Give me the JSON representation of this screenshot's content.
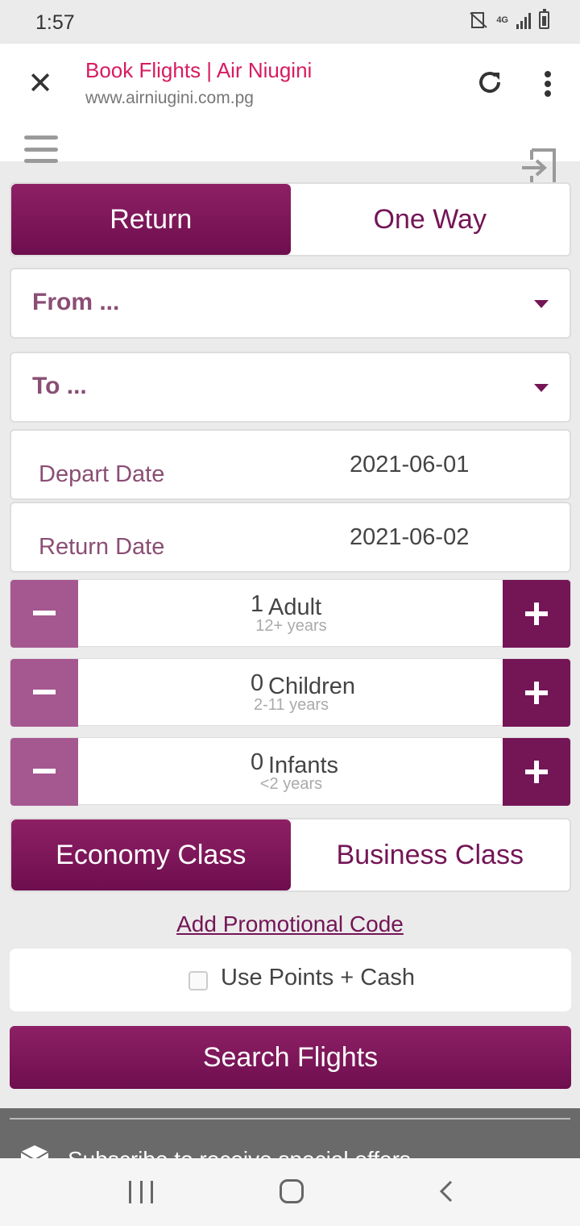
{
  "status_bar": {
    "time": "1:57",
    "network": "4G"
  },
  "browser": {
    "title": "Book Flights | Air Niugini",
    "url": "www.airniugini.com.pg"
  },
  "trip_type": {
    "options": [
      "Return",
      "One Way"
    ],
    "selected": "Return"
  },
  "from": {
    "placeholder": "From ..."
  },
  "to": {
    "placeholder": "To ..."
  },
  "dates": {
    "depart_label": "Depart Date",
    "depart_value": "2021-06-01",
    "return_label": "Return Date",
    "return_value": "2021-06-02"
  },
  "passengers": [
    {
      "count": "1",
      "label": "Adult",
      "sub": "12+ years"
    },
    {
      "count": "0",
      "label": "Children",
      "sub": "2-11 years"
    },
    {
      "count": "0",
      "label": "Infants",
      "sub": "<2 years"
    }
  ],
  "cabin_class": {
    "options": [
      "Economy Class",
      "Business Class"
    ],
    "selected": "Economy Class"
  },
  "promo_link": "Add Promotional Code",
  "points_cash": {
    "label": "Use Points + Cash",
    "checked": false
  },
  "search_button": "Search Flights",
  "footer": {
    "subscribe_text": "Subscribe to receive special offers"
  },
  "colors": {
    "brand": "#741556",
    "brand_light": "#a55790",
    "title_pink": "#d81b60"
  }
}
